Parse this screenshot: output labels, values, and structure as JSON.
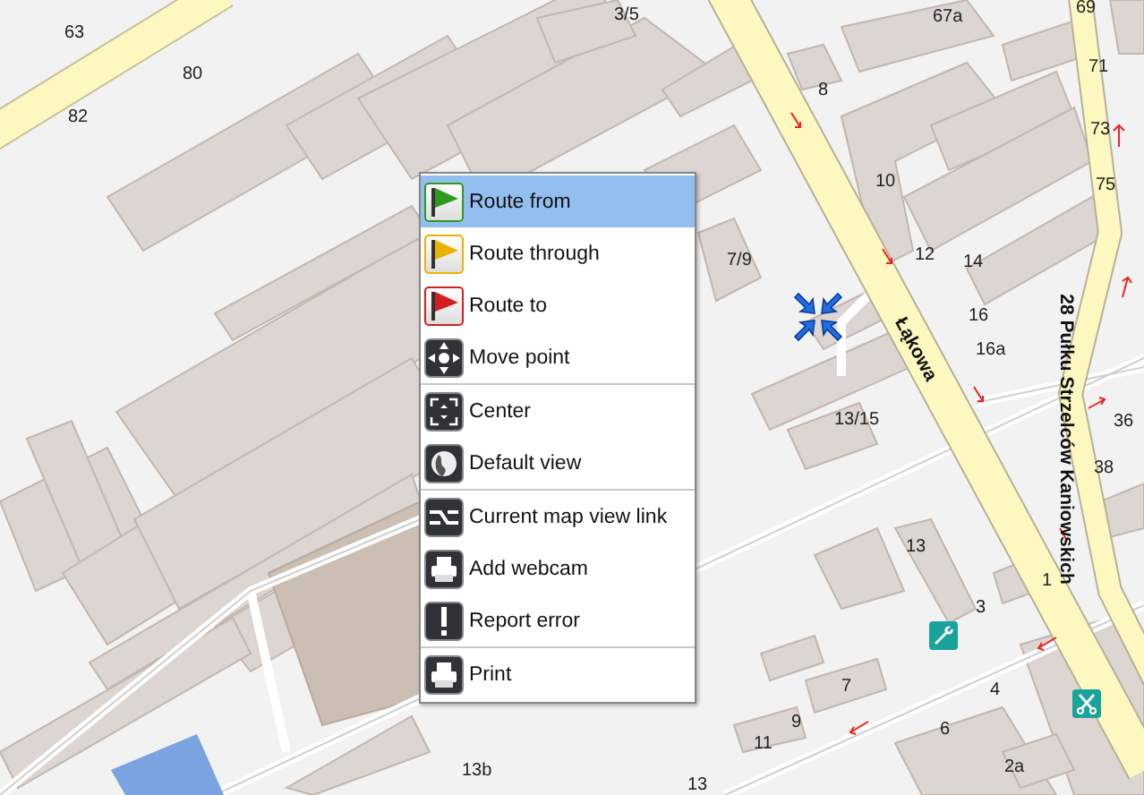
{
  "map": {
    "house_numbers": [
      "63",
      "80",
      "82",
      "3/5",
      "67a",
      "69",
      "8",
      "71",
      "73",
      "10",
      "75",
      "7/9",
      "12",
      "14",
      "16",
      "16a",
      "36",
      "13/15",
      "38",
      "13",
      "1",
      "3",
      "7",
      "4",
      "9",
      "6",
      "11",
      "2a",
      "13b",
      "13"
    ],
    "streets": [
      {
        "name": "Łąkowa"
      },
      {
        "name": "28 Pułku Strzelców Kaniowskich"
      }
    ]
  },
  "context_menu": {
    "groups": [
      [
        {
          "label": "Route from",
          "kind": "flag",
          "color": "#2e9a1e",
          "selected": true
        },
        {
          "label": "Route through",
          "kind": "flag",
          "color": "#e8b400",
          "selected": false
        },
        {
          "label": "Route to",
          "kind": "flag",
          "color": "#d21f1f",
          "selected": false
        },
        {
          "label": "Move point",
          "kind": "move",
          "selected": false
        }
      ],
      [
        {
          "label": "Center",
          "kind": "center",
          "selected": false
        },
        {
          "label": "Default view",
          "kind": "globe",
          "selected": false
        }
      ],
      [
        {
          "label": "Current map view link",
          "kind": "link",
          "selected": false
        },
        {
          "label": "Add webcam",
          "kind": "printer",
          "selected": false
        },
        {
          "label": "Report error",
          "kind": "alert",
          "selected": false
        }
      ],
      [
        {
          "label": "Print",
          "kind": "printer",
          "selected": false
        }
      ]
    ]
  }
}
